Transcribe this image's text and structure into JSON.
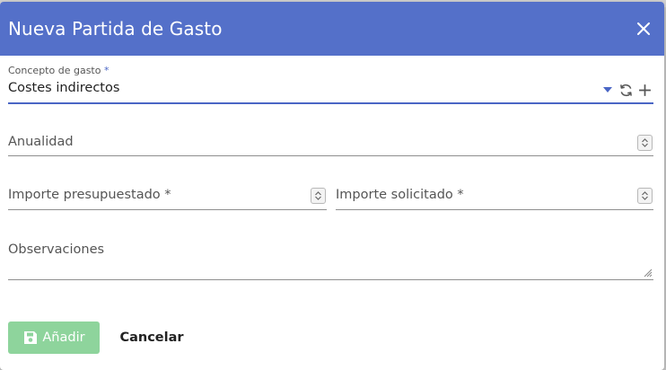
{
  "dialog": {
    "title": "Nueva Partida de Gasto",
    "close_icon": "close-icon"
  },
  "form": {
    "concepto": {
      "label": "Concepto de gasto",
      "required_mark": "*",
      "value": "Costes indirectos",
      "icons": [
        "chevron-down-icon",
        "refresh-icon",
        "plus-icon"
      ]
    },
    "anualidad": {
      "placeholder": "Anualidad"
    },
    "importe_presupuestado": {
      "placeholder": "Importe presupuestado *"
    },
    "importe_solicitado": {
      "placeholder": "Importe solicitado *"
    },
    "observaciones": {
      "placeholder": "Observaciones"
    }
  },
  "actions": {
    "add_label": "Añadir",
    "add_icon": "save-icon",
    "cancel_label": "Cancelar"
  },
  "colors": {
    "header": "#5470c9",
    "accent": "#4a66c5",
    "add_button": "#8ed49c"
  }
}
